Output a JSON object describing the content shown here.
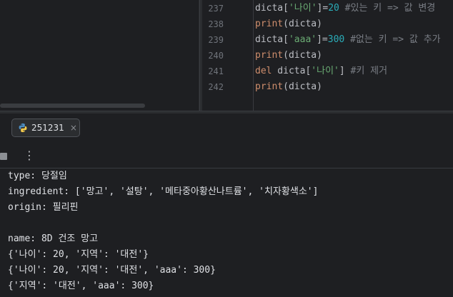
{
  "editor": {
    "lines": [
      {
        "num": "237",
        "tokens": [
          {
            "t": "dicta[",
            "c": "var"
          },
          {
            "t": "'나이'",
            "c": "str"
          },
          {
            "t": "]=",
            "c": "var"
          },
          {
            "t": "20",
            "c": "num"
          },
          {
            "t": " #있는 키 => 값 변경",
            "c": "cmt"
          }
        ]
      },
      {
        "num": "238",
        "tokens": [
          {
            "t": "print",
            "c": "kw"
          },
          {
            "t": "(dicta)",
            "c": "var"
          }
        ]
      },
      {
        "num": "239",
        "tokens": [
          {
            "t": "dicta[",
            "c": "var"
          },
          {
            "t": "'aaa'",
            "c": "str"
          },
          {
            "t": "]=",
            "c": "var"
          },
          {
            "t": "300",
            "c": "num"
          },
          {
            "t": " #없는 키 => 값 추가",
            "c": "cmt"
          }
        ]
      },
      {
        "num": "240",
        "tokens": [
          {
            "t": "print",
            "c": "kw"
          },
          {
            "t": "(dicta)",
            "c": "var"
          }
        ]
      },
      {
        "num": "241",
        "tokens": [
          {
            "t": "del",
            "c": "kw"
          },
          {
            "t": " dicta[",
            "c": "var"
          },
          {
            "t": "'나이'",
            "c": "str"
          },
          {
            "t": "] ",
            "c": "var"
          },
          {
            "t": "#키 제거",
            "c": "cmt"
          }
        ]
      },
      {
        "num": "242",
        "tokens": [
          {
            "t": "print",
            "c": "kw"
          },
          {
            "t": "(dicta)",
            "c": "var"
          }
        ]
      }
    ]
  },
  "run_tab": {
    "label": "251231",
    "close": "×",
    "icon": "python-icon"
  },
  "toolbar": {
    "more": "⋮"
  },
  "console": {
    "lines": [
      "type: 당절임",
      "ingredient: ['망고', '설탕', '메타중아황산나트륨', '치자황색소']",
      "origin: 필리핀",
      "",
      "name: 8D 건조 망고",
      "{'나이': 20, '지역': '대전'}",
      "{'나이': 20, '지역': '대전', 'aaa': 300}",
      "{'지역': '대전', 'aaa': 300}"
    ]
  }
}
